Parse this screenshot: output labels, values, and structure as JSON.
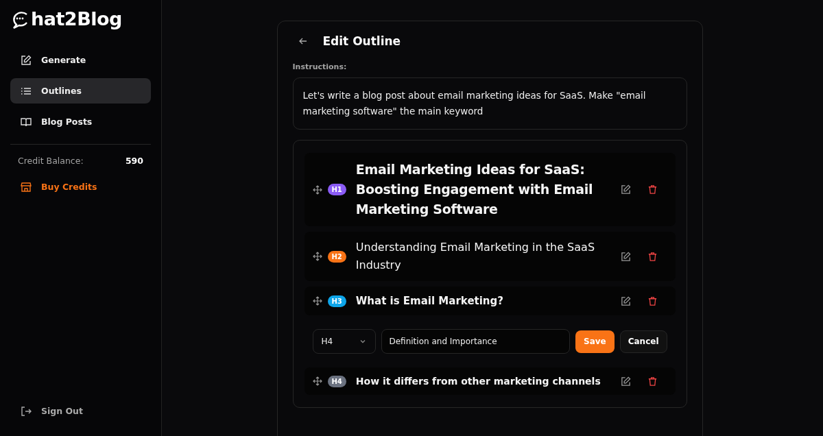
{
  "logo": {
    "text": "hat2Blog"
  },
  "sidebar": {
    "items": [
      {
        "label": "Generate",
        "kind": "edit",
        "selected": false
      },
      {
        "label": "Outlines",
        "kind": "list",
        "selected": true
      },
      {
        "label": "Blog Posts",
        "kind": "book",
        "selected": false
      }
    ],
    "credit_balance": {
      "label": "Credit Balance:",
      "value": "590"
    },
    "buy_credits": "Buy Credits",
    "sign_out": "Sign Out"
  },
  "page": {
    "title": "Edit Outline",
    "instructions_label": "Instructions:",
    "instructions": "Let's write a blog post about email marketing ideas for SaaS. Make \"email marketing software\" the main keyword"
  },
  "outline": [
    {
      "kind": "h1",
      "tag": "H1",
      "color": "#8b5cf6",
      "text": "Email Marketing Ideas for SaaS: Boosting Engagement with Email Marketing Software"
    },
    {
      "kind": "h2",
      "tag": "H2",
      "color": "#f97316",
      "text": "Understanding Email Marketing in the SaaS Industry"
    },
    {
      "kind": "h3",
      "tag": "H3",
      "color": "#0ea5e9",
      "text": "What is Email Marketing?"
    },
    {
      "kind": "editor",
      "tag": "H4",
      "value": "Definition and Importance",
      "save": "Save",
      "cancel": "Cancel"
    },
    {
      "kind": "h4",
      "tag": "H4",
      "color": "#6b7280",
      "text": "How it differs from other marketing channels"
    }
  ]
}
